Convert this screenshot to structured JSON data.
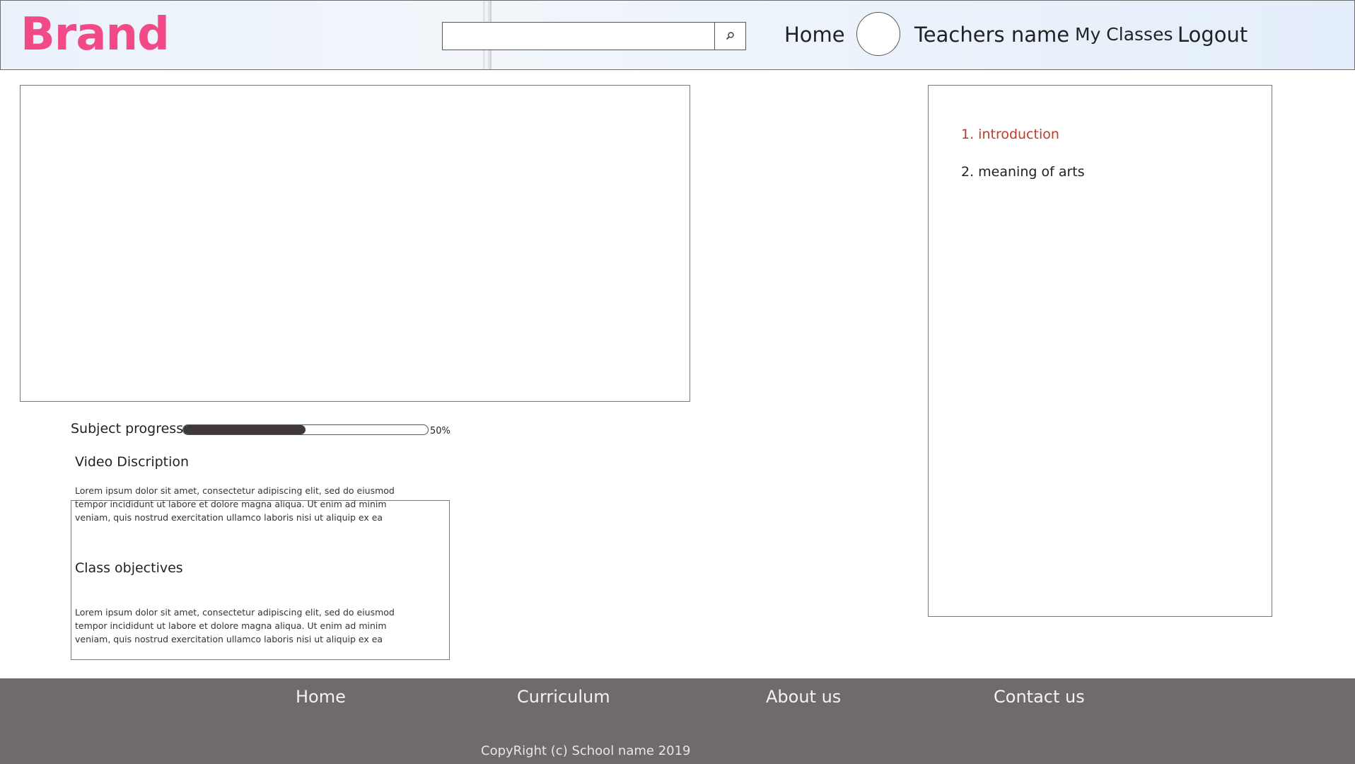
{
  "header": {
    "brand": "Brand",
    "search": {
      "value": "",
      "placeholder": ""
    },
    "nav": {
      "home": "Home",
      "teacher_name": "Teachers name",
      "my_classes": "My Classes",
      "logout": "Logout"
    }
  },
  "progress": {
    "label": "Subject progress",
    "percent_text": "50%",
    "value_percent": 50
  },
  "description": {
    "heading": "Video Discription",
    "text": "Lorem ipsum dolor sit amet, consectetur adipiscing elit, sed do eiusmod tempor incididunt ut labore et dolore magna aliqua. Ut enim ad minim veniam, quis nostrud exercitation ullamco laboris nisi ut aliquip ex ea"
  },
  "objectives": {
    "heading": "Class objectives",
    "text": "Lorem ipsum dolor sit amet, consectetur adipiscing elit, sed do eiusmod tempor incididunt ut labore et dolore magna aliqua. Ut enim ad minim veniam, quis nostrud exercitation ullamco laboris nisi ut aliquip ex ea"
  },
  "chapters": [
    {
      "label": "1. introduction",
      "active": true
    },
    {
      "label": "2. meaning of arts",
      "active": false
    }
  ],
  "footer": {
    "links": {
      "home": "Home",
      "curriculum": "Curriculum",
      "about": "About us",
      "contact": "Contact us"
    },
    "copyright": "CopyRight (c) School name 2019"
  },
  "colors": {
    "brand": "#f24a86",
    "active_chapter": "#c0392b",
    "progress_fill": "#3e3838",
    "footer_bg": "#706a6a"
  },
  "icons": {
    "search": "search-icon",
    "avatar": "avatar"
  }
}
